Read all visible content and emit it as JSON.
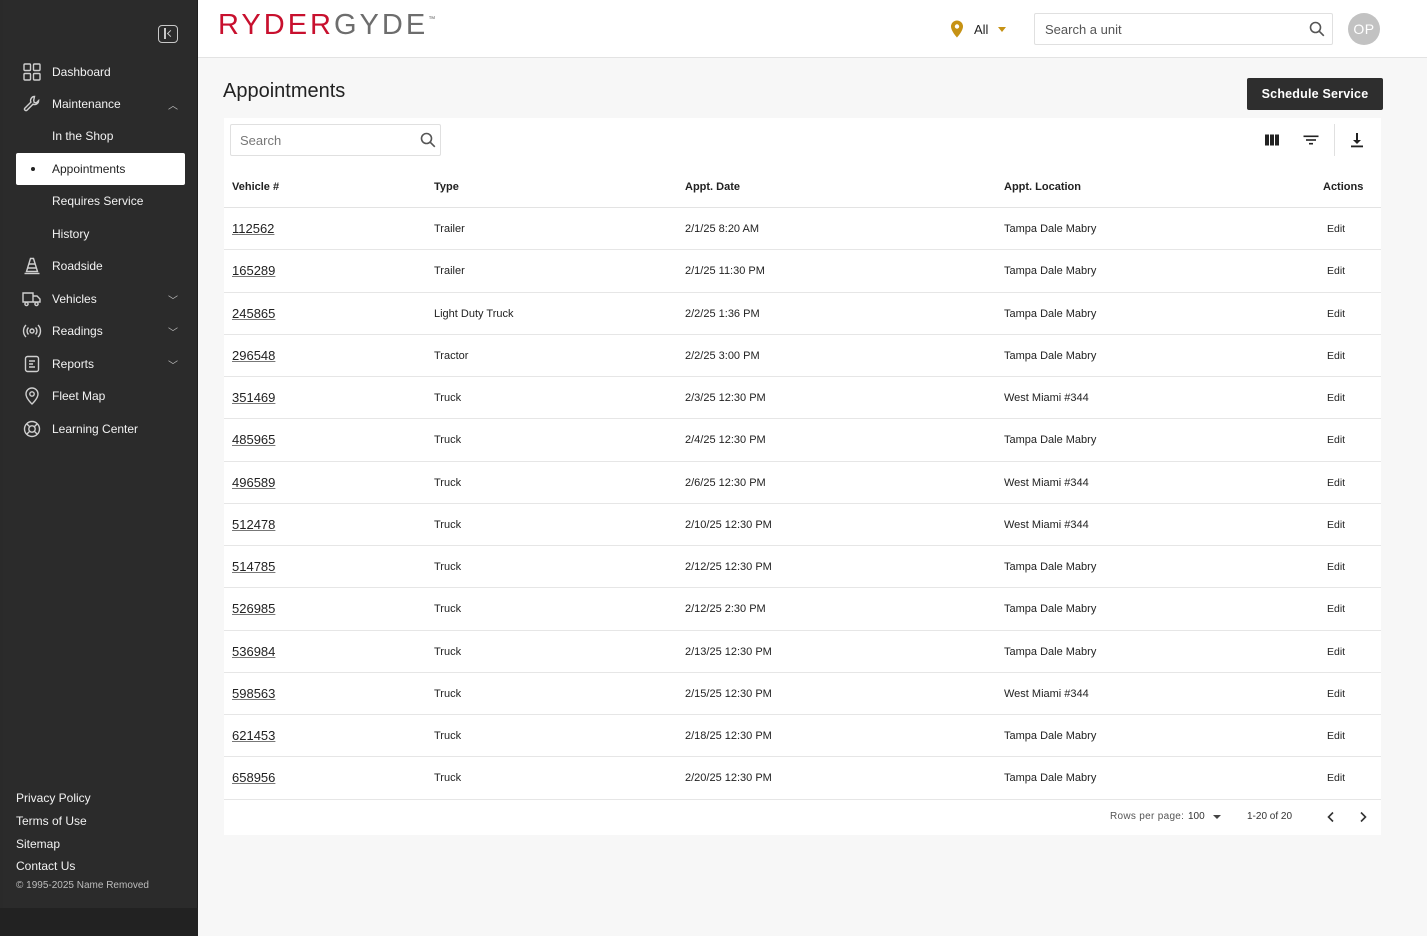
{
  "sidebar": {
    "items": [
      {
        "label": "Dashboard"
      },
      {
        "label": "Maintenance"
      },
      {
        "label": "In the Shop"
      },
      {
        "label": "Appointments"
      },
      {
        "label": "Requires Service"
      },
      {
        "label": "History"
      },
      {
        "label": "Roadside"
      },
      {
        "label": "Vehicles"
      },
      {
        "label": "Readings"
      },
      {
        "label": "Reports"
      },
      {
        "label": "Fleet Map"
      },
      {
        "label": "Learning Center"
      }
    ],
    "footer": [
      "Privacy Policy",
      "Terms of Use",
      "Sitemap",
      "Contact Us"
    ],
    "copyright": "© 1995-2025 Name Removed"
  },
  "header": {
    "logo_a": "RYDER",
    "logo_b": "GYDE",
    "logo_tm": "™",
    "location_filter": "All",
    "unit_search_placeholder": "Search a unit",
    "avatar_initials": "OP"
  },
  "main": {
    "title": "Appointments",
    "schedule_button": "Schedule Service",
    "table_search_placeholder": "Search",
    "columns": [
      "Vehicle #",
      "Type",
      "Appt. Date",
      "Appt. Location",
      "Actions"
    ],
    "rows": [
      {
        "vehicle": "112562",
        "type": "Trailer",
        "date": "2/1/25 8:20 AM",
        "location": "Tampa Dale Mabry",
        "action": "Edit"
      },
      {
        "vehicle": "165289",
        "type": "Trailer",
        "date": "2/1/25 11:30 PM",
        "location": "Tampa Dale Mabry",
        "action": "Edit"
      },
      {
        "vehicle": "245865",
        "type": "Light Duty Truck",
        "date": "2/2/25 1:36 PM",
        "location": "Tampa Dale Mabry",
        "action": "Edit"
      },
      {
        "vehicle": "296548",
        "type": "Tractor",
        "date": "2/2/25 3:00 PM",
        "location": "Tampa Dale Mabry",
        "action": "Edit"
      },
      {
        "vehicle": "351469",
        "type": "Truck",
        "date": "2/3/25 12:30 PM",
        "location": "West Miami #344",
        "action": "Edit"
      },
      {
        "vehicle": "485965",
        "type": "Truck",
        "date": "2/4/25 12:30 PM",
        "location": "Tampa Dale Mabry",
        "action": "Edit"
      },
      {
        "vehicle": "496589",
        "type": "Truck",
        "date": "2/6/25 12:30 PM",
        "location": "West Miami #344",
        "action": "Edit"
      },
      {
        "vehicle": "512478",
        "type": "Truck",
        "date": "2/10/25 12:30 PM",
        "location": "West Miami #344",
        "action": "Edit"
      },
      {
        "vehicle": "514785",
        "type": "Truck",
        "date": "2/12/25 12:30 PM",
        "location": "Tampa Dale Mabry",
        "action": "Edit"
      },
      {
        "vehicle": "526985",
        "type": "Truck",
        "date": "2/12/25 2:30 PM",
        "location": "Tampa Dale Mabry",
        "action": "Edit"
      },
      {
        "vehicle": "536984",
        "type": "Truck",
        "date": "2/13/25 12:30 PM",
        "location": "Tampa Dale Mabry",
        "action": "Edit"
      },
      {
        "vehicle": "598563",
        "type": "Truck",
        "date": "2/15/25 12:30 PM",
        "location": "West Miami #344",
        "action": "Edit"
      },
      {
        "vehicle": "621453",
        "type": "Truck",
        "date": "2/18/25 12:30 PM",
        "location": "Tampa Dale Mabry",
        "action": "Edit"
      },
      {
        "vehicle": "658956",
        "type": "Truck",
        "date": "2/20/25 12:30 PM",
        "location": "Tampa Dale Mabry",
        "action": "Edit"
      }
    ],
    "pagination": {
      "rows_per_page_label": "Rows per page:",
      "rows_per_page": "100",
      "range": "1-20 of 20"
    }
  },
  "colors": {
    "sidebar_bg": "#2b2b2b",
    "brand_red": "#c8102e",
    "accent_gold": "#c69214",
    "button_dark": "#2e2e2e"
  }
}
